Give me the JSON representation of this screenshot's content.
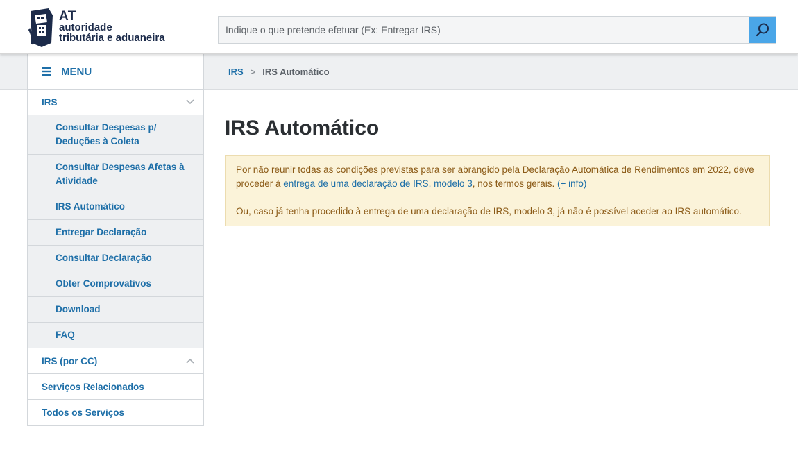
{
  "header": {
    "logo": {
      "abbr": "AT",
      "line1": "autoridade",
      "line2": "tributária e aduaneira"
    },
    "search": {
      "placeholder": "Indique o que pretende efetuar (Ex: Entregar IRS)",
      "button_icon": "search-icon"
    }
  },
  "breadcrumb": {
    "root": "IRS",
    "separator": ">",
    "current": "IRS Automático"
  },
  "sidebar": {
    "menu_label": "MENU",
    "menu_icon": "hamburger-icon",
    "groups": [
      {
        "label": "IRS",
        "expanded": true,
        "icon": "chevron-down-icon",
        "items": [
          {
            "label": "Consultar Despesas p/ Deduções à Coleta"
          },
          {
            "label": "Consultar Despesas Afetas à Atividade"
          },
          {
            "label": "IRS Automático"
          },
          {
            "label": "Entregar Declaração"
          },
          {
            "label": "Consultar Declaração"
          },
          {
            "label": "Obter Comprovativos"
          },
          {
            "label": "Download"
          },
          {
            "label": "FAQ"
          }
        ]
      },
      {
        "label": "IRS (por CC)",
        "expanded": false,
        "icon": "chevron-up-icon"
      },
      {
        "label": "Serviços Relacionados"
      },
      {
        "label": "Todos os Serviços"
      }
    ]
  },
  "main": {
    "title": "IRS Automático",
    "alert": {
      "p1_text_a": "Por não reunir todas as condições previstas para ser abrangido pela Declaração Automática de Rendimentos em 2022, deve proceder à ",
      "p1_link": "entrega de uma declaração de IRS, modelo 3",
      "p1_text_b": ", nos termos gerais. ",
      "p1_info_link": "(+ info)",
      "p2": "Ou, caso já tenha procedido à entrega de uma declaração de IRS, modelo 3, já não é possível aceder ao IRS automático."
    }
  },
  "colors": {
    "accent": "#1e6fa8",
    "search_button": "#4aa6e8",
    "alert_bg": "#fbf3d9",
    "alert_text": "#8b5a16"
  }
}
